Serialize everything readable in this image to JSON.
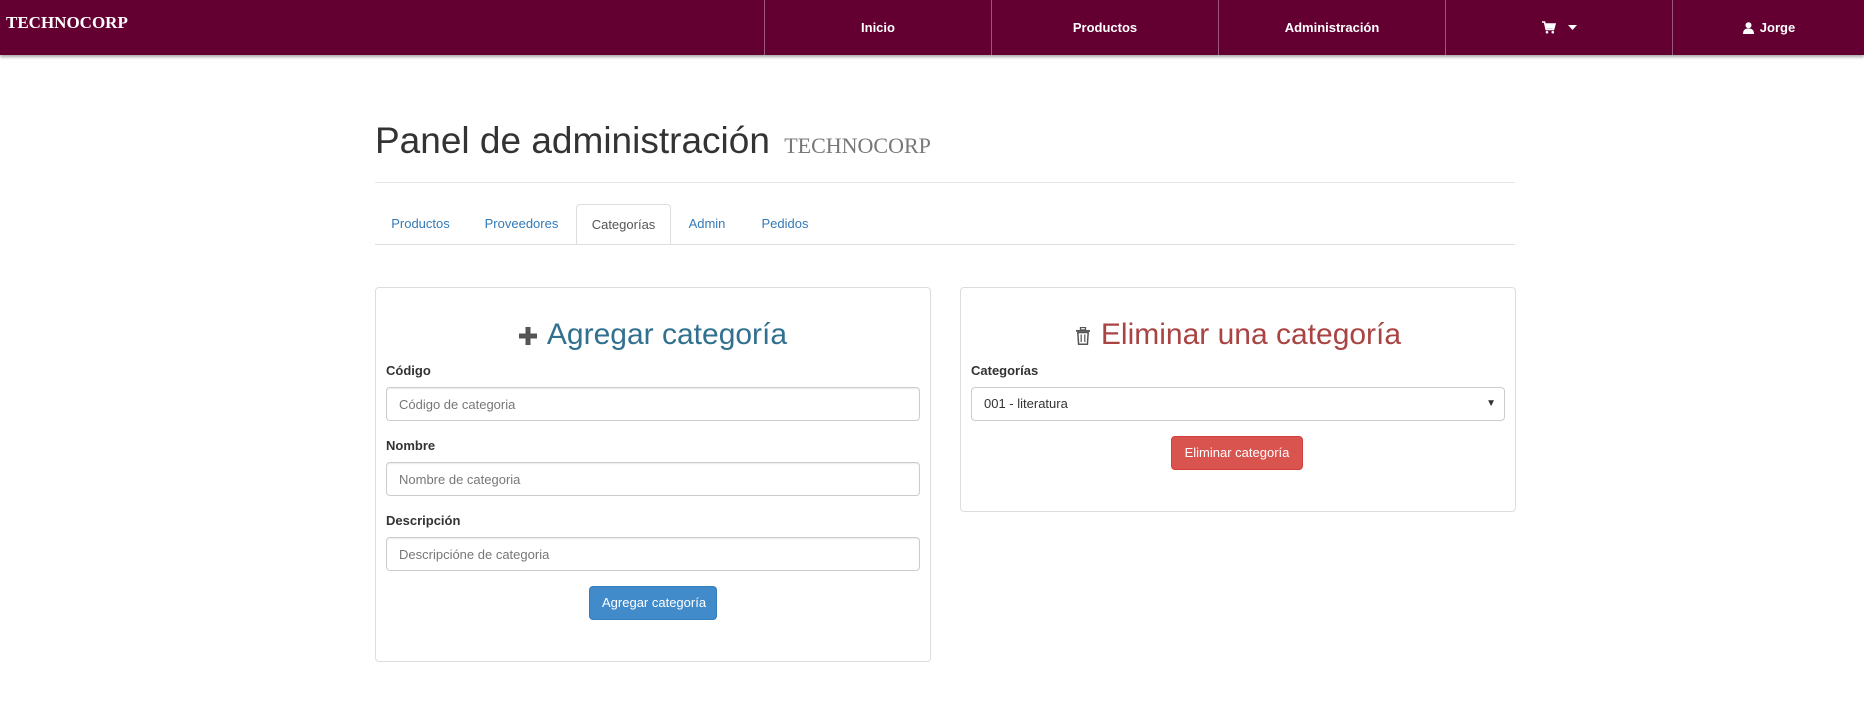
{
  "navbar": {
    "brand": "TECHNOCORP",
    "links": [
      {
        "label": "Inicio"
      },
      {
        "label": "Productos"
      },
      {
        "label": "Administración"
      }
    ],
    "cart_icon": "shopping-cart-icon",
    "cart_dropdown_icon": "caret-down-icon",
    "user": {
      "icon": "user-icon",
      "label": "Jorge"
    }
  },
  "page": {
    "title": "Panel de administración",
    "subtitle": "TECHNOCORP"
  },
  "tabs": [
    {
      "label": "Productos",
      "active": false
    },
    {
      "label": "Proveedores",
      "active": false
    },
    {
      "label": "Categorías",
      "active": true
    },
    {
      "label": "Admin",
      "active": false
    },
    {
      "label": "Pedidos",
      "active": false
    }
  ],
  "add_panel": {
    "icon": "plus-icon",
    "title": "Agregar categoría",
    "code_label": "Código",
    "code_placeholder": "Código de categoria",
    "code_value": "",
    "name_label": "Nombre",
    "name_placeholder": "Nombre de categoria",
    "name_value": "",
    "desc_label": "Descripción",
    "desc_placeholder": "Descripcióne de categoria",
    "desc_value": "",
    "submit_label": "Agregar categoría"
  },
  "delete_panel": {
    "icon": "trash-icon",
    "title": "Eliminar una categoría",
    "select_label": "Categorías",
    "selected_value": "001 - literatura",
    "submit_label": "Eliminar categoría"
  },
  "colors": {
    "navbar": "#630031",
    "link": "#337ab7",
    "add_heading": "#31708f",
    "delete_heading": "#a94442",
    "primary_button": "#428bca",
    "danger_button": "#d9534f"
  }
}
